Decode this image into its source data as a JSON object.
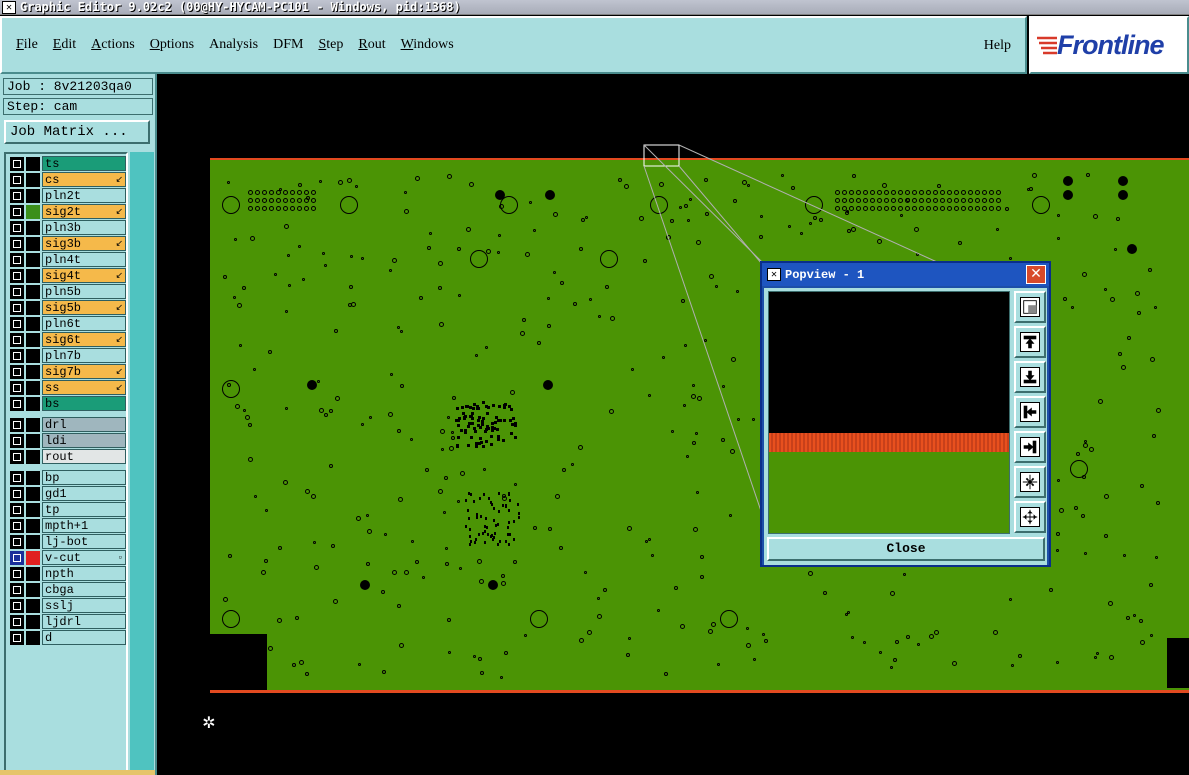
{
  "window": {
    "title": "Graphic Editor 9.02c2 (00@HY-HYCAM-PC101 - Windows, pid:1368)",
    "close_glyph": "✕"
  },
  "menubar": {
    "items": [
      "File",
      "Edit",
      "Actions",
      "Options",
      "Analysis",
      "DFM",
      "Step",
      "Rout",
      "Windows"
    ],
    "underlined": [
      true,
      true,
      true,
      true,
      false,
      false,
      true,
      true,
      true
    ],
    "help": "Help",
    "logo_text": "Frontline"
  },
  "job": {
    "job_label": "Job : 8v21203qa0",
    "step_label": "Step: cam",
    "matrix_button": "Job Matrix ..."
  },
  "layers": [
    {
      "name": "ts",
      "color": "#1a9c78",
      "swatch": "#000000",
      "mark": ""
    },
    {
      "name": "cs",
      "color": "#f5b94a",
      "swatch": "#000000",
      "mark": "↙"
    },
    {
      "name": "pln2t",
      "color": "#a9dedf",
      "swatch": "#000000",
      "mark": ""
    },
    {
      "name": "sig2t",
      "color": "#f5b94a",
      "swatch": "#3b8f1a",
      "mark": "↙"
    },
    {
      "name": "pln3b",
      "color": "#a9dedf",
      "swatch": "#000000",
      "mark": ""
    },
    {
      "name": "sig3b",
      "color": "#f5b94a",
      "swatch": "#000000",
      "mark": "↙"
    },
    {
      "name": "pln4t",
      "color": "#a9dedf",
      "swatch": "#000000",
      "mark": ""
    },
    {
      "name": "sig4t",
      "color": "#f5b94a",
      "swatch": "#000000",
      "mark": "↙"
    },
    {
      "name": "pln5b",
      "color": "#a9dedf",
      "swatch": "#000000",
      "mark": ""
    },
    {
      "name": "sig5b",
      "color": "#f5b94a",
      "swatch": "#000000",
      "mark": "↙"
    },
    {
      "name": "pln6t",
      "color": "#a9dedf",
      "swatch": "#000000",
      "mark": ""
    },
    {
      "name": "sig6t",
      "color": "#f5b94a",
      "swatch": "#000000",
      "mark": "↙"
    },
    {
      "name": "pln7b",
      "color": "#a9dedf",
      "swatch": "#000000",
      "mark": ""
    },
    {
      "name": "sig7b",
      "color": "#f5b94a",
      "swatch": "#000000",
      "mark": "↙"
    },
    {
      "name": "ss",
      "color": "#f5b94a",
      "swatch": "#000000",
      "mark": "↙"
    },
    {
      "name": "bs",
      "color": "#1a9c78",
      "swatch": "#000000",
      "mark": ""
    },
    {
      "name": "drl",
      "color": "#9fb6be",
      "swatch": "#000000",
      "mark": ""
    },
    {
      "name": "ldi",
      "color": "#9fb6be",
      "swatch": "#000000",
      "mark": ""
    },
    {
      "name": "rout",
      "color": "#e2e6e6",
      "swatch": "#000000",
      "mark": ""
    },
    {
      "name": "bp",
      "color": "#a9dedf",
      "swatch": "#000000",
      "mark": ""
    },
    {
      "name": "gd1",
      "color": "#a9dedf",
      "swatch": "#000000",
      "mark": ""
    },
    {
      "name": "tp",
      "color": "#a9dedf",
      "swatch": "#000000",
      "mark": ""
    },
    {
      "name": "mpth+1",
      "color": "#a9dedf",
      "swatch": "#000000",
      "mark": ""
    },
    {
      "name": "lj-bot",
      "color": "#a9dedf",
      "swatch": "#000000",
      "mark": ""
    },
    {
      "name": "v-cut",
      "color": "#a9dedf",
      "swatch": "#e02020",
      "mark": "▫",
      "active": true
    },
    {
      "name": "npth",
      "color": "#a9dedf",
      "swatch": "#000000",
      "mark": ""
    },
    {
      "name": "cbga",
      "color": "#a9dedf",
      "swatch": "#000000",
      "mark": ""
    },
    {
      "name": "sslj",
      "color": "#a9dedf",
      "swatch": "#000000",
      "mark": ""
    },
    {
      "name": "ljdrl",
      "color": "#a9dedf",
      "swatch": "#000000",
      "mark": ""
    },
    {
      "name": "d",
      "color": "#a9dedf",
      "swatch": "#000000",
      "mark": ""
    }
  ],
  "popview": {
    "title": "Popview - 1",
    "close_x": "✕",
    "close_button": "Close",
    "tools": [
      "zoom-fit-icon",
      "pan-up-icon",
      "pan-down-icon",
      "pan-left-icon",
      "pan-right-icon",
      "zoom-out-icon",
      "zoom-in-icon"
    ]
  },
  "colors": {
    "panel": "#a9dedf",
    "board": "#4b9405",
    "edge": "#e24a20",
    "popview_frame": "#1c4fa8"
  }
}
